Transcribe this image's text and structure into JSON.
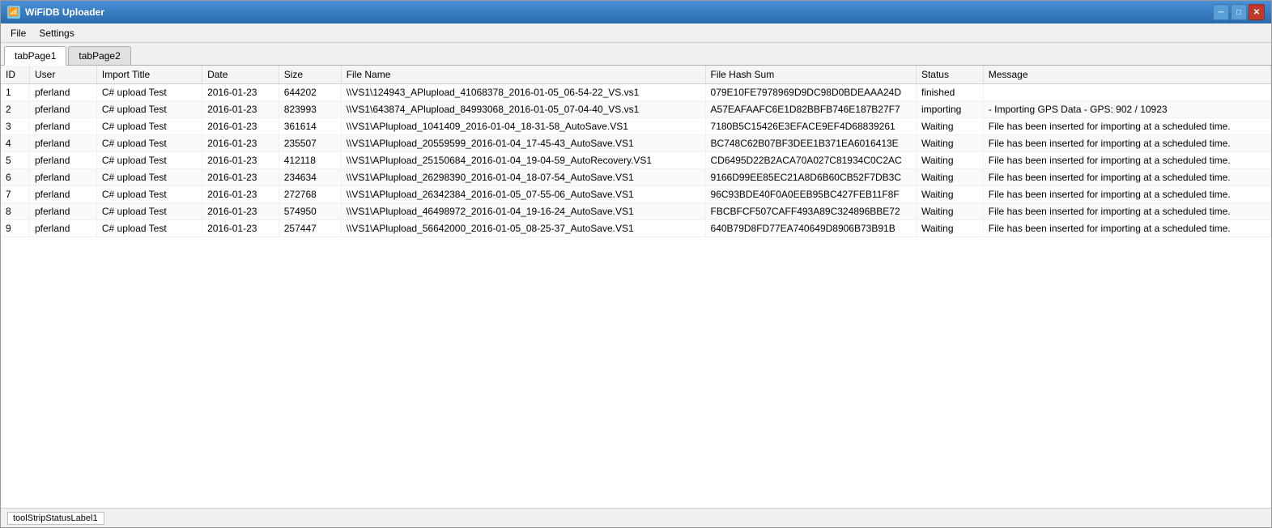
{
  "window": {
    "title": "WiFiDB Uploader",
    "min_btn": "─",
    "max_btn": "□",
    "close_btn": "✕"
  },
  "menu": {
    "items": [
      "File",
      "Settings"
    ]
  },
  "tabs": [
    {
      "label": "tabPage1",
      "active": true
    },
    {
      "label": "tabPage2",
      "active": false
    }
  ],
  "table": {
    "columns": [
      "ID",
      "User",
      "Import Title",
      "Date",
      "Size",
      "File Name",
      "File Hash Sum",
      "Status",
      "Message"
    ],
    "rows": [
      {
        "id": "1",
        "user": "pferland",
        "import_title": "C# upload Test",
        "date": "2016-01-23",
        "size": "644202",
        "filename": "\\\\VS1\\124943_APlupload_41068378_2016-01-05_06-54-22_VS.vs1",
        "hash": "079E10FE7978969D9DC98D0BDEAAA24D",
        "status": "finished",
        "message": ""
      },
      {
        "id": "2",
        "user": "pferland",
        "import_title": "C# upload Test",
        "date": "2016-01-23",
        "size": "823993",
        "filename": "\\\\VS1\\643874_APlupload_84993068_2016-01-05_07-04-40_VS.vs1",
        "hash": "A57EAFAAFC6E1D82BBFB746E187B27F7",
        "status": "importing",
        "message": " - Importing GPS Data - GPS: 902 / 10923"
      },
      {
        "id": "3",
        "user": "pferland",
        "import_title": "C# upload Test",
        "date": "2016-01-23",
        "size": "361614",
        "filename": "\\\\VS1\\APlupload_1041409_2016-01-04_18-31-58_AutoSave.VS1",
        "hash": "7180B5C15426E3EFACE9EF4D68839261",
        "status": "Waiting",
        "message": "File has been inserted for importing at a scheduled time."
      },
      {
        "id": "4",
        "user": "pferland",
        "import_title": "C# upload Test",
        "date": "2016-01-23",
        "size": "235507",
        "filename": "\\\\VS1\\APlupload_20559599_2016-01-04_17-45-43_AutoSave.VS1",
        "hash": "BC748C62B07BF3DEE1B371EA6016413E",
        "status": "Waiting",
        "message": "File has been inserted for importing at a scheduled time."
      },
      {
        "id": "5",
        "user": "pferland",
        "import_title": "C# upload Test",
        "date": "2016-01-23",
        "size": "412118",
        "filename": "\\\\VS1\\APlupload_25150684_2016-01-04_19-04-59_AutoRecovery.VS1",
        "hash": "CD6495D22B2ACA70A027C81934C0C2AC",
        "status": "Waiting",
        "message": "File has been inserted for importing at a scheduled time."
      },
      {
        "id": "6",
        "user": "pferland",
        "import_title": "C# upload Test",
        "date": "2016-01-23",
        "size": "234634",
        "filename": "\\\\VS1\\APlupload_26298390_2016-01-04_18-07-54_AutoSave.VS1",
        "hash": "9166D99EE85EC21A8D6B60CB52F7DB3C",
        "status": "Waiting",
        "message": "File has been inserted for importing at a scheduled time."
      },
      {
        "id": "7",
        "user": "pferland",
        "import_title": "C# upload Test",
        "date": "2016-01-23",
        "size": "272768",
        "filename": "\\\\VS1\\APlupload_26342384_2016-01-05_07-55-06_AutoSave.VS1",
        "hash": "96C93BDE40F0A0EEB95BC427FEB11F8F",
        "status": "Waiting",
        "message": "File has been inserted for importing at a scheduled time."
      },
      {
        "id": "8",
        "user": "pferland",
        "import_title": "C# upload Test",
        "date": "2016-01-23",
        "size": "574950",
        "filename": "\\\\VS1\\APlupload_46498972_2016-01-04_19-16-24_AutoSave.VS1",
        "hash": "FBCBFCF507CAFF493A89C324896BBE72",
        "status": "Waiting",
        "message": "File has been inserted for importing at a scheduled time."
      },
      {
        "id": "9",
        "user": "pferland",
        "import_title": "C# upload Test",
        "date": "2016-01-23",
        "size": "257447",
        "filename": "\\\\VS1\\APlupload_56642000_2016-01-05_08-25-37_AutoSave.VS1",
        "hash": "640B79D8FD77EA740649D8906B73B91B",
        "status": "Waiting",
        "message": "File has been inserted for importing at a scheduled time."
      }
    ]
  },
  "status_bar": {
    "label": "toolStripStatusLabel1"
  }
}
